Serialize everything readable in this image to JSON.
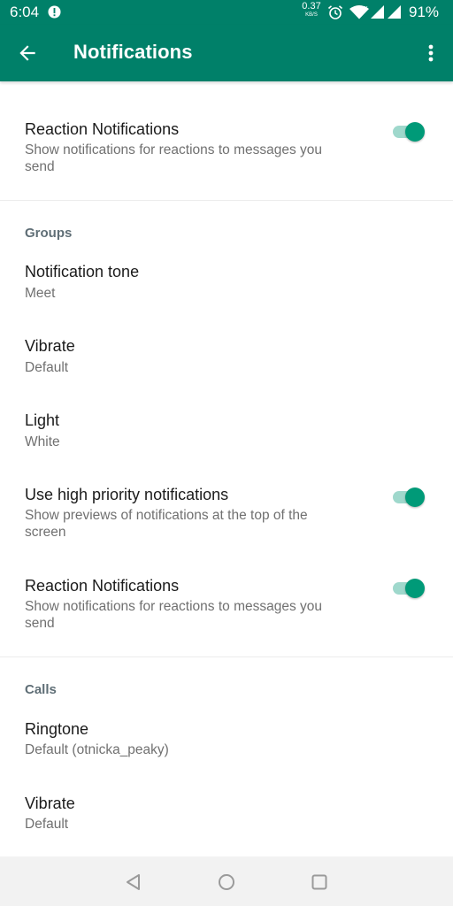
{
  "status_bar": {
    "time": "6:04",
    "net_speed_value": "0.37",
    "net_speed_unit": "KB/S",
    "battery": "91%",
    "icons": [
      "alert-icon",
      "alarm-icon",
      "wifi-icon",
      "signal-icon",
      "signal-icon"
    ]
  },
  "app_bar": {
    "title": "Notifications",
    "icons": [
      "back-arrow-icon",
      "more-vert-icon"
    ]
  },
  "colors": {
    "accent": "#008069",
    "toggle_on": "#009a78",
    "toggle_track": "#9fd8cc",
    "section_header": "#5f6e76"
  },
  "top": {
    "reaction": {
      "title": "Reaction Notifications",
      "subtitle": "Show notifications for reactions to messages you send",
      "enabled": true
    }
  },
  "groups": {
    "header": "Groups",
    "tone": {
      "title": "Notification tone",
      "value": "Meet"
    },
    "vibrate": {
      "title": "Vibrate",
      "value": "Default"
    },
    "light": {
      "title": "Light",
      "value": "White"
    },
    "high_priority": {
      "title": "Use high priority notifications",
      "subtitle": "Show previews of notifications at the top of the screen",
      "enabled": true
    },
    "reaction": {
      "title": "Reaction Notifications",
      "subtitle": "Show notifications for reactions to messages you send",
      "enabled": true
    }
  },
  "calls": {
    "header": "Calls",
    "ringtone": {
      "title": "Ringtone",
      "value": "Default (otnicka_peaky)"
    },
    "vibrate": {
      "title": "Vibrate",
      "value": "Default"
    }
  },
  "nav_bar": {
    "icons": [
      "nav-back-icon",
      "nav-home-icon",
      "nav-recents-icon"
    ]
  }
}
